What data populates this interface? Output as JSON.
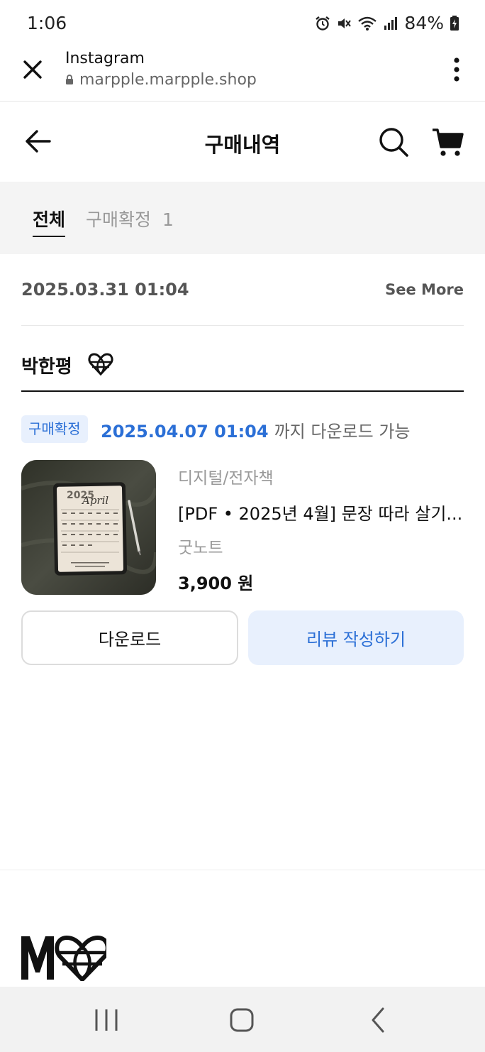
{
  "status_bar": {
    "time": "1:06",
    "battery": "84%",
    "icons": [
      "alarm-icon",
      "mute-icon",
      "wifi-icon",
      "signal-icon",
      "battery-charging-icon"
    ]
  },
  "browser": {
    "title": "Instagram",
    "url": "marpple.marpple.shop"
  },
  "header": {
    "title": "구매내역"
  },
  "tabs": [
    {
      "label": "전체",
      "active": true
    },
    {
      "label": "구매확정",
      "count": "1",
      "active": false
    }
  ],
  "order": {
    "date": "2025.03.31 01:04",
    "see_more": "See More",
    "seller": "박한평",
    "status_badge": "구매확정",
    "download_deadline": "2025.04.07 01:04",
    "download_suffix": "까지 다운로드 가능",
    "product": {
      "category": "디지털/전자책",
      "name": "[PDF • 2025년 4월] 문장 따라 살기...",
      "option": "굿노트",
      "price": "3,900 원",
      "thumb_year": "2025",
      "thumb_month": "April"
    },
    "buttons": {
      "download": "다운로드",
      "review": "리뷰 작성하기"
    }
  },
  "colors": {
    "accent_blue": "#2b6fd6",
    "badge_bg": "#e8f0fd"
  }
}
